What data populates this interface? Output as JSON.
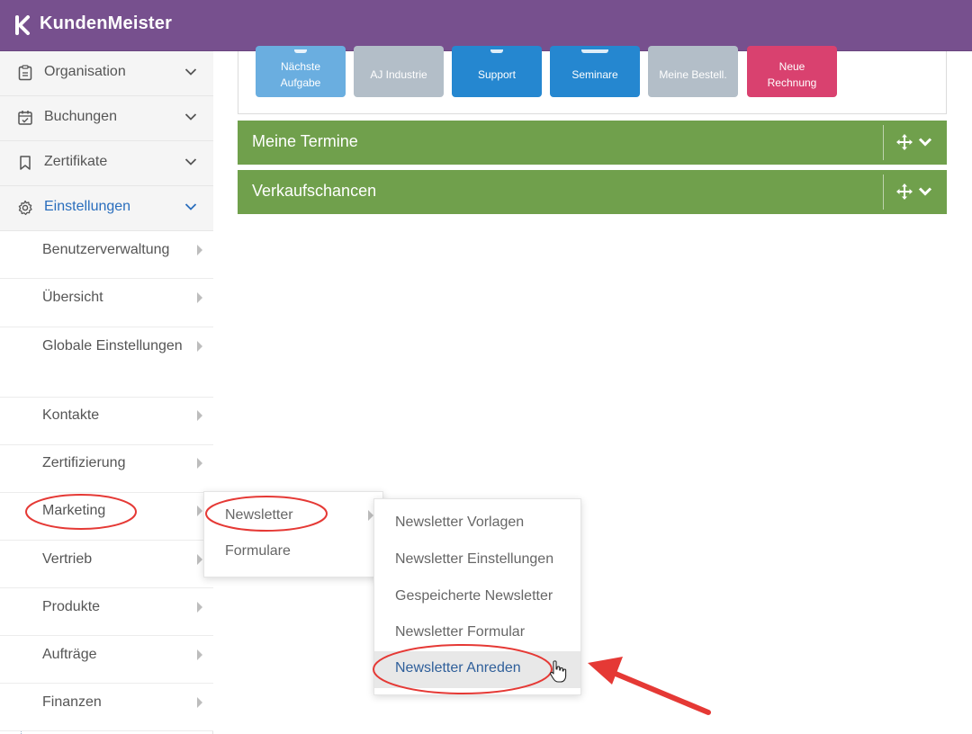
{
  "app": {
    "name": "KundenMeister",
    "brand_color": "#77508e"
  },
  "sidebar": {
    "top_items": [
      {
        "label": "Organisation",
        "icon": "clipboard-icon"
      },
      {
        "label": "Buchungen",
        "icon": "calendar-check-icon"
      },
      {
        "label": "Zertifikate",
        "icon": "bookmark-icon"
      },
      {
        "label": "Einstellungen",
        "icon": "gear-icon",
        "active": true
      }
    ],
    "sub_items": [
      {
        "label": "Benutzerverwaltung"
      },
      {
        "label": "Übersicht"
      },
      {
        "label": "Globale Einstellungen"
      },
      {
        "label": "Kontakte"
      },
      {
        "label": "Zertifizierung"
      },
      {
        "label": "Marketing"
      },
      {
        "label": "Vertrieb"
      },
      {
        "label": "Produkte"
      },
      {
        "label": "Aufträge"
      },
      {
        "label": "Finanzen"
      }
    ]
  },
  "tiles": [
    {
      "label_1": "Nächste",
      "label_2": "Aufgabe",
      "color": "#6aaee0"
    },
    {
      "label_1": "AJ Industrie",
      "label_2": "",
      "color": "#b3bec8"
    },
    {
      "label_1": "Support",
      "label_2": "",
      "color": "#2587d0"
    },
    {
      "label_1": "Seminare",
      "label_2": "",
      "color": "#2587d0"
    },
    {
      "label_1": "Meine Bestell.",
      "label_2": "",
      "color": "#b3bec8"
    },
    {
      "label_1": "Neue",
      "label_2": "Rechnung",
      "color": "#d9416f"
    }
  ],
  "panels": [
    {
      "title": "Meine Termine"
    },
    {
      "title": "Verkaufschancen"
    }
  ],
  "marketing_menu": {
    "items": [
      {
        "label": "Newsletter"
      },
      {
        "label": "Formulare"
      }
    ]
  },
  "newsletter_menu": {
    "items": [
      {
        "label": "Newsletter Vorlagen"
      },
      {
        "label": "Newsletter Einstellungen"
      },
      {
        "label": "Gespeicherte Newsletter"
      },
      {
        "label": "Newsletter Formular"
      },
      {
        "label": "Newsletter Anreden",
        "highlighted": true
      }
    ]
  },
  "annotation_color": "#e53935"
}
